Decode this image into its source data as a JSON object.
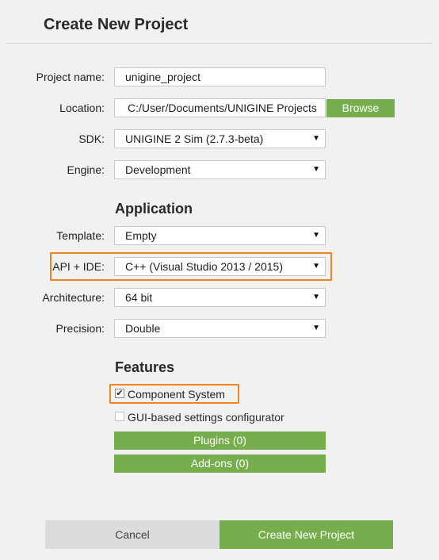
{
  "header": {
    "title": "Create New Project"
  },
  "form": {
    "project_name": {
      "label": "Project name:",
      "value": "unigine_project"
    },
    "location": {
      "label": "Location:",
      "value": "C:/User/Documents/UNIGINE Projects",
      "browse_label": "Browse"
    },
    "sdk": {
      "label": "SDK:",
      "value": "UNIGINE 2 Sim (2.7.3-beta)"
    },
    "engine": {
      "label": "Engine:",
      "value": "Development"
    }
  },
  "application": {
    "title": "Application",
    "template": {
      "label": "Template:",
      "value": "Empty"
    },
    "api_ide": {
      "label": "API + IDE:",
      "value": "C++ (Visual Studio 2013 / 2015)"
    },
    "architecture": {
      "label": "Architecture:",
      "value": "64 bit"
    },
    "precision": {
      "label": "Precision:",
      "value": "Double"
    }
  },
  "features": {
    "title": "Features",
    "component_system": {
      "label": "Component System",
      "checked": true,
      "check_glyph": "✔"
    },
    "gui_configurator": {
      "label": "GUI-based settings configurator",
      "checked": false
    },
    "plugins_label": "Plugins (0)",
    "addons_label": "Add-ons (0)"
  },
  "footer": {
    "cancel_label": "Cancel",
    "create_label": "Create New Project"
  },
  "colors": {
    "accent_green": "#76ae4d",
    "highlight_orange": "#f0841e",
    "background": "#f1f1f1"
  },
  "icons": {
    "dropdown": "chevron-down-icon",
    "checkbox": "checkmark-icon"
  }
}
